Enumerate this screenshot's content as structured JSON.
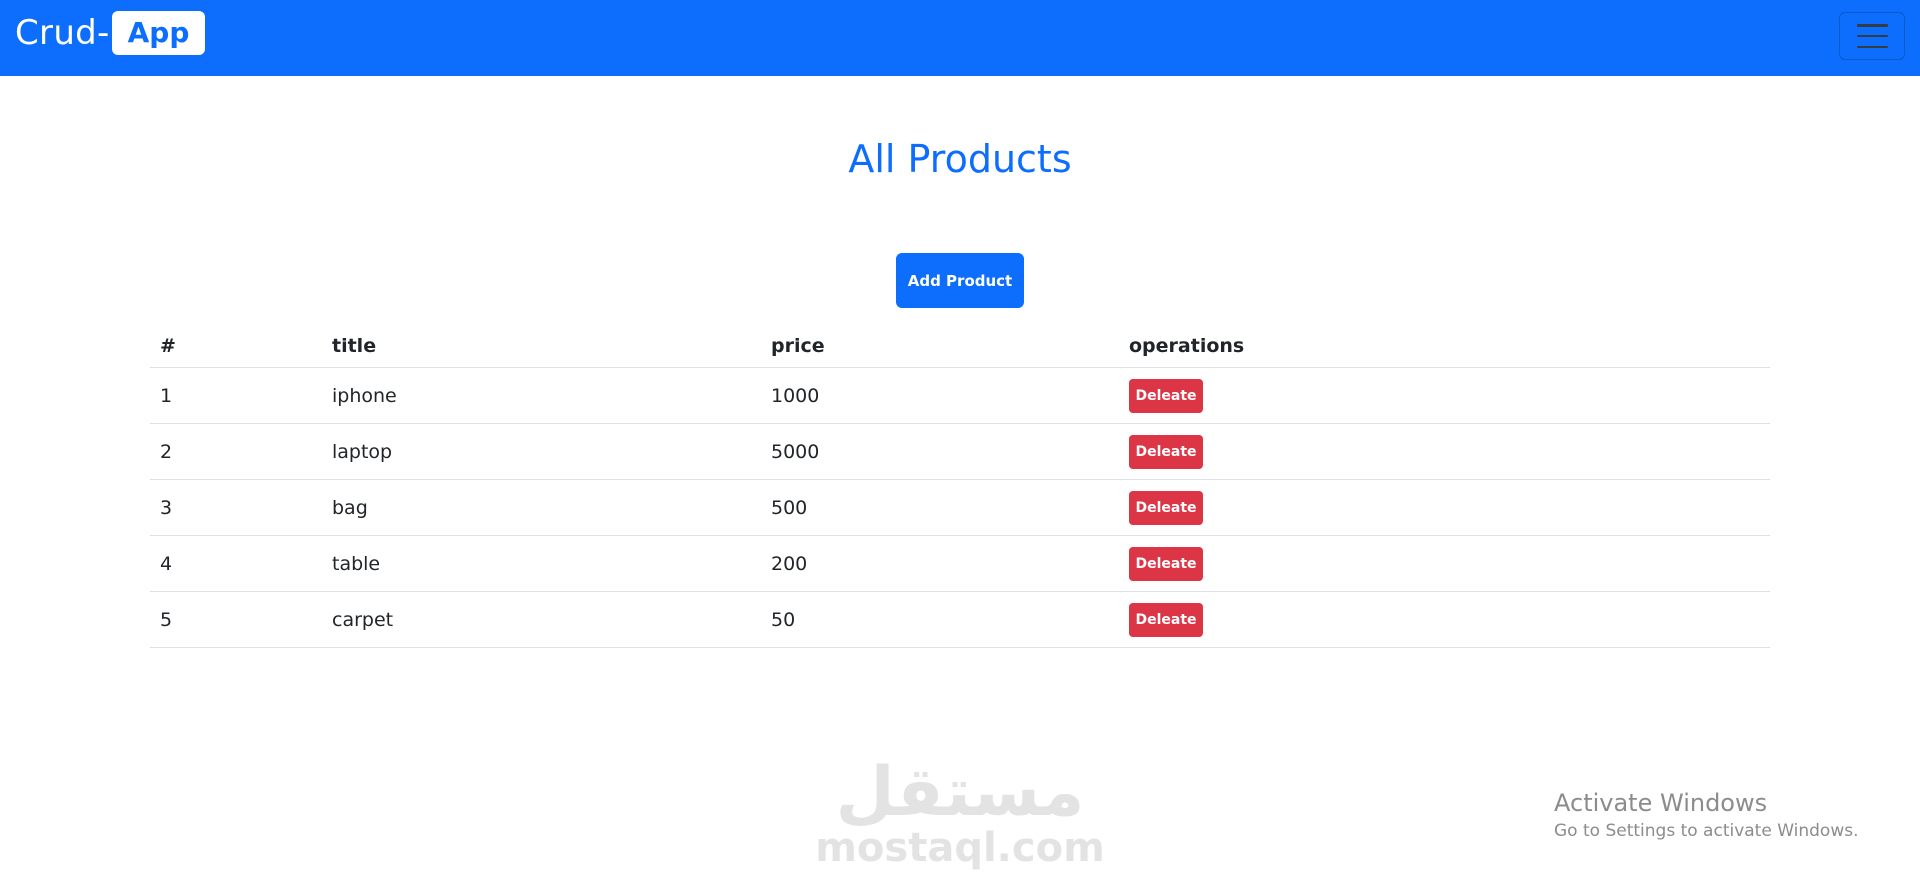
{
  "navbar": {
    "brand_text": "Crud-",
    "brand_badge": "App",
    "toggler_icon": "hamburger-menu-icon"
  },
  "page": {
    "title": "All Products",
    "add_button_label": "Add Product"
  },
  "table": {
    "headers": [
      "#",
      "title",
      "price",
      "operations"
    ],
    "rows": [
      {
        "num": "1",
        "title": "iphone",
        "price": "1000",
        "action": "Deleate"
      },
      {
        "num": "2",
        "title": "laptop",
        "price": "5000",
        "action": "Deleate"
      },
      {
        "num": "3",
        "title": "bag",
        "price": "500",
        "action": "Deleate"
      },
      {
        "num": "4",
        "title": "table",
        "price": "200",
        "action": "Deleate"
      },
      {
        "num": "5",
        "title": "carpet",
        "price": "50",
        "action": "Deleate"
      }
    ]
  },
  "watermark": {
    "arabic": "مستقل",
    "latin": "mostaql.com"
  },
  "os_overlay": {
    "title": "Activate Windows",
    "subtitle": "Go to Settings to activate Windows."
  },
  "colors": {
    "primary": "#0d6efd",
    "danger": "#dc3545",
    "navbar_bg": "#0d6efd",
    "title_color": "#0d6efd"
  }
}
